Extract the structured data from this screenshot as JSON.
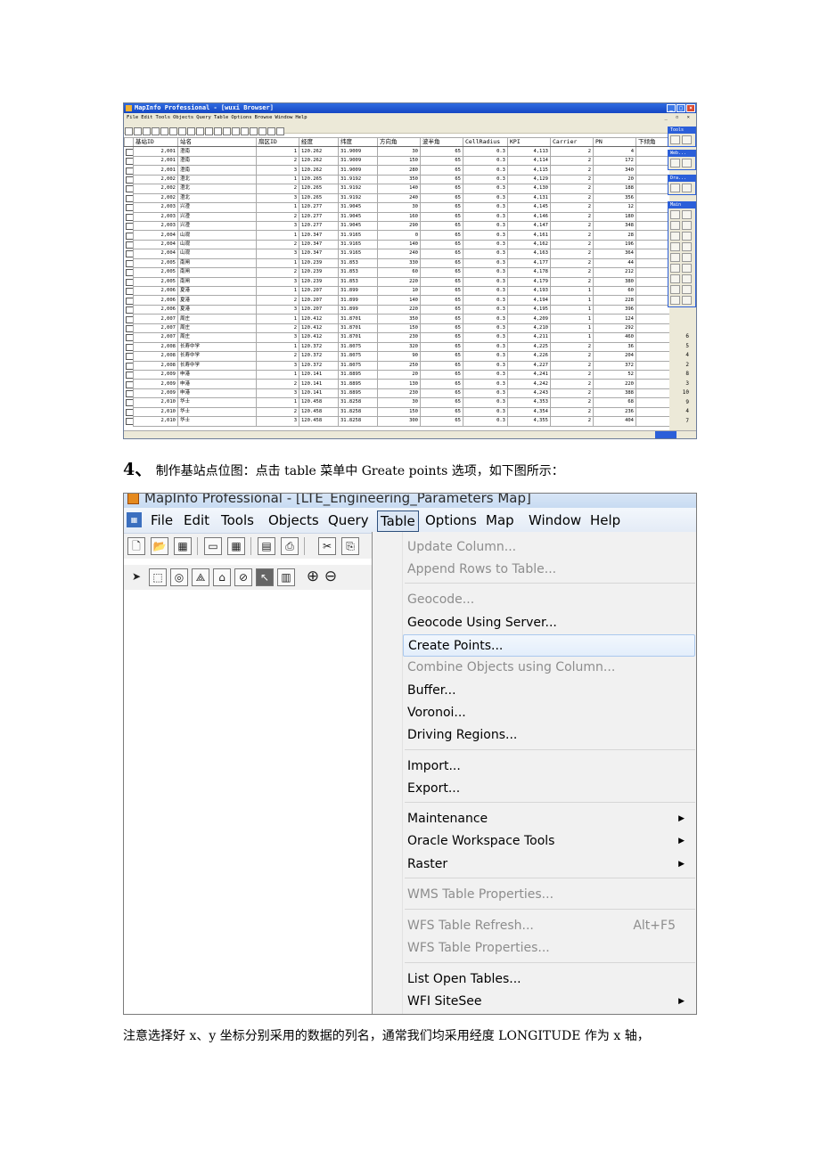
{
  "shot1": {
    "title": "MapInfo Professional - [wuxi Browser]",
    "menu": [
      "File",
      "Edit",
      "Tools",
      "Objects",
      "Query",
      "Table",
      "Options",
      "Browse",
      "Window",
      "Help"
    ],
    "columns": [
      "基站ID",
      "站名",
      "扇区ID",
      "经度",
      "纬度",
      "方向角",
      "波半角",
      "CellRadius",
      "KPI",
      "Carrier",
      "PN",
      "下倾角"
    ],
    "rows": [
      [
        "2,001",
        "澄南",
        "1",
        "120.262",
        "31.9009",
        "30",
        "65",
        "0.3",
        "4,113",
        "2",
        "4"
      ],
      [
        "2,001",
        "澄南",
        "2",
        "120.262",
        "31.9009",
        "150",
        "65",
        "0.3",
        "4,114",
        "2",
        "172"
      ],
      [
        "2,001",
        "澄南",
        "3",
        "120.262",
        "31.9009",
        "280",
        "65",
        "0.3",
        "4,115",
        "2",
        "340"
      ],
      [
        "2,002",
        "澄北",
        "1",
        "120.265",
        "31.9192",
        "350",
        "65",
        "0.3",
        "4,129",
        "2",
        "20"
      ],
      [
        "2,002",
        "澄北",
        "2",
        "120.265",
        "31.9192",
        "140",
        "65",
        "0.3",
        "4,130",
        "2",
        "188"
      ],
      [
        "2,002",
        "澄北",
        "3",
        "120.265",
        "31.9192",
        "240",
        "65",
        "0.3",
        "4,131",
        "2",
        "356"
      ],
      [
        "2,003",
        "兴澄",
        "1",
        "120.277",
        "31.9045",
        "30",
        "65",
        "0.3",
        "4,145",
        "2",
        "12"
      ],
      [
        "2,003",
        "兴澄",
        "2",
        "120.277",
        "31.9045",
        "160",
        "65",
        "0.3",
        "4,146",
        "2",
        "180"
      ],
      [
        "2,003",
        "兴澄",
        "3",
        "120.277",
        "31.9045",
        "290",
        "65",
        "0.3",
        "4,147",
        "2",
        "348"
      ],
      [
        "2,004",
        "山观",
        "1",
        "120.347",
        "31.9165",
        "0",
        "65",
        "0.3",
        "4,161",
        "2",
        "28"
      ],
      [
        "2,004",
        "山观",
        "2",
        "120.347",
        "31.9165",
        "140",
        "65",
        "0.3",
        "4,162",
        "2",
        "196"
      ],
      [
        "2,004",
        "山观",
        "3",
        "120.347",
        "31.9165",
        "240",
        "65",
        "0.3",
        "4,163",
        "2",
        "364"
      ],
      [
        "2,005",
        "南闸",
        "1",
        "120.239",
        "31.853",
        "330",
        "65",
        "0.3",
        "4,177",
        "2",
        "44"
      ],
      [
        "2,005",
        "南闸",
        "2",
        "120.239",
        "31.853",
        "60",
        "65",
        "0.3",
        "4,178",
        "2",
        "212"
      ],
      [
        "2,005",
        "南闸",
        "3",
        "120.239",
        "31.853",
        "220",
        "65",
        "0.3",
        "4,179",
        "2",
        "380"
      ],
      [
        "2,006",
        "夏港",
        "1",
        "120.207",
        "31.899",
        "10",
        "65",
        "0.3",
        "4,193",
        "1",
        "60"
      ],
      [
        "2,006",
        "夏港",
        "2",
        "120.207",
        "31.899",
        "140",
        "65",
        "0.3",
        "4,194",
        "1",
        "228"
      ],
      [
        "2,006",
        "夏港",
        "3",
        "120.207",
        "31.899",
        "220",
        "65",
        "0.3",
        "4,195",
        "1",
        "396"
      ],
      [
        "2,007",
        "周庄",
        "1",
        "120.412",
        "31.8701",
        "350",
        "65",
        "0.3",
        "4,209",
        "1",
        "124"
      ],
      [
        "2,007",
        "周庄",
        "2",
        "120.412",
        "31.8701",
        "150",
        "65",
        "0.3",
        "4,210",
        "1",
        "292"
      ],
      [
        "2,007",
        "周庄",
        "3",
        "120.412",
        "31.8701",
        "230",
        "65",
        "0.3",
        "4,211",
        "1",
        "460"
      ],
      [
        "2,008",
        "长寿中学",
        "1",
        "120.372",
        "31.8075",
        "320",
        "65",
        "0.3",
        "4,225",
        "2",
        "36"
      ],
      [
        "2,008",
        "长寿中学",
        "2",
        "120.372",
        "31.8075",
        "90",
        "65",
        "0.3",
        "4,226",
        "2",
        "204"
      ],
      [
        "2,008",
        "长寿中学",
        "3",
        "120.372",
        "31.8075",
        "250",
        "65",
        "0.3",
        "4,227",
        "2",
        "372"
      ],
      [
        "2,009",
        "申港",
        "1",
        "120.141",
        "31.8895",
        "20",
        "65",
        "0.3",
        "4,241",
        "2",
        "52"
      ],
      [
        "2,009",
        "申港",
        "2",
        "120.141",
        "31.8895",
        "130",
        "65",
        "0.3",
        "4,242",
        "2",
        "220"
      ],
      [
        "2,009",
        "申港",
        "3",
        "120.141",
        "31.8895",
        "230",
        "65",
        "0.3",
        "4,243",
        "2",
        "388"
      ],
      [
        "2,010",
        "华士",
        "1",
        "120.458",
        "31.8258",
        "30",
        "65",
        "0.3",
        "4,353",
        "2",
        "68"
      ],
      [
        "2,010",
        "华士",
        "2",
        "120.458",
        "31.8258",
        "150",
        "65",
        "0.3",
        "4,354",
        "2",
        "236"
      ],
      [
        "2,010",
        "华士",
        "3",
        "120.458",
        "31.8258",
        "300",
        "65",
        "0.3",
        "4,355",
        "2",
        "404"
      ]
    ],
    "tilt_visible": [
      "6",
      "5",
      "4",
      "2",
      "8",
      "3",
      "10",
      "9",
      "4",
      "7"
    ],
    "palettes": [
      "Tools",
      "Web...",
      "Dra...",
      "Main"
    ]
  },
  "caption": {
    "number": "4、",
    "text": "制作基站点位图：点击 table 菜单中 Greate points 选项，如下图所示："
  },
  "shot2": {
    "title": "MapInfo Professional - [LTE_Engineering_Parameters Map]",
    "menu": [
      "File",
      "Edit",
      "Tools",
      "Objects",
      "Query",
      "Table",
      "Options",
      "Map",
      "Window",
      "Help"
    ],
    "items": [
      {
        "label": "Update Column...",
        "disabled": true
      },
      {
        "label": "Append Rows to Table...",
        "disabled": true
      },
      {
        "label": "Geocode...",
        "disabled": true
      },
      {
        "label": "Geocode Using Server...",
        "disabled": false
      },
      {
        "label": "Create Points...",
        "disabled": false,
        "highlighted": true
      },
      {
        "label": "Combine Objects using Column...",
        "disabled": true
      },
      {
        "label": "Buffer...",
        "disabled": false
      },
      {
        "label": "Voronoi...",
        "disabled": false
      },
      {
        "label": "Driving Regions...",
        "disabled": false
      },
      {
        "label": "Import...",
        "disabled": false
      },
      {
        "label": "Export...",
        "disabled": false
      },
      {
        "label": "Maintenance",
        "disabled": false,
        "submenu": true
      },
      {
        "label": "Oracle Workspace Tools",
        "disabled": false,
        "submenu": true
      },
      {
        "label": "Raster",
        "disabled": false,
        "submenu": true
      },
      {
        "label": "WMS Table Properties...",
        "disabled": true
      },
      {
        "label": "WFS Table Refresh...",
        "disabled": true,
        "shortcut": "Alt+F5"
      },
      {
        "label": "WFS Table Properties...",
        "disabled": true
      },
      {
        "label": "List Open Tables...",
        "disabled": false
      },
      {
        "label": "WFI SiteSee",
        "disabled": false,
        "submenu": true
      }
    ]
  },
  "paragraph": "注意选择好 x、y 坐标分别采用的数据的列名，通常我们均采用经度 LONGITUDE 作为 x 轴，"
}
